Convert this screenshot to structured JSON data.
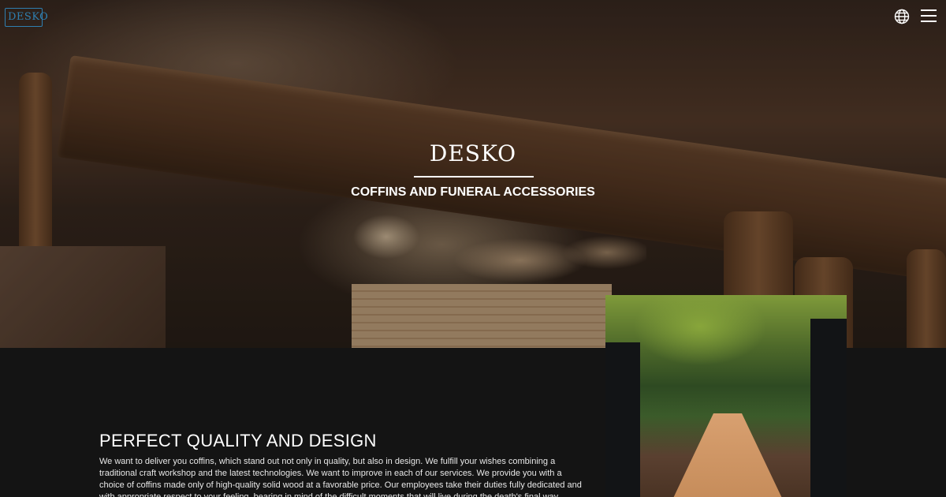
{
  "header": {
    "logo_text": "DESKO",
    "globe_icon": "globe-icon",
    "menu_icon": "hamburger-menu-icon"
  },
  "hero": {
    "title": "DESKO",
    "subtitle": "COFFINS AND FUNERAL ACCESSORIES"
  },
  "section": {
    "heading": "PERFECT QUALITY AND DESIGN",
    "body": "We want to deliver you coffins, which stand out not only in quality, but also in design. We fulfill your wishes combining a traditional craft workshop and the latest technologies. We want to improve in each of our services. We provide you with a choice of coffins made only of high-quality solid wood at a favorable price. Our employees take their duties fully dedicated and with appropriate respect to your feeling, bearing in mind of the difficult moments that will live during the death's final way."
  },
  "colors": {
    "background": "#141414",
    "logo_accent": "#2f7fb0",
    "text": "#ffffff"
  }
}
